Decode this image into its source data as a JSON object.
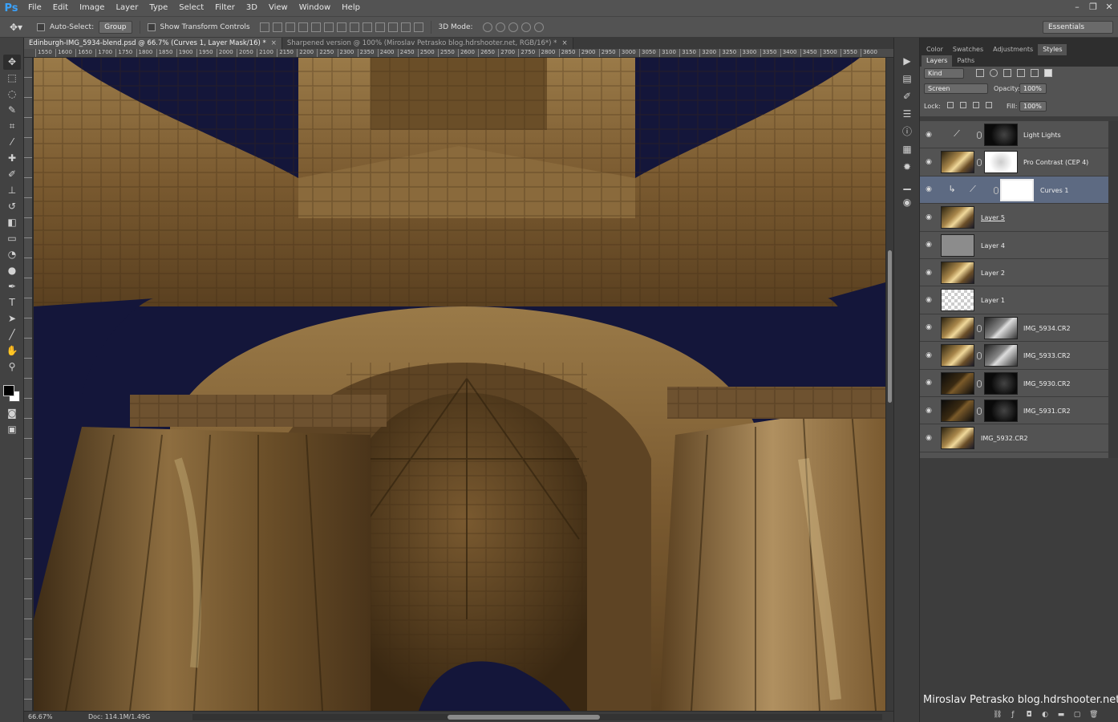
{
  "app": {
    "logo": "Ps"
  },
  "menu": [
    "File",
    "Edit",
    "Image",
    "Layer",
    "Type",
    "Select",
    "Filter",
    "3D",
    "View",
    "Window",
    "Help"
  ],
  "window_controls": [
    "–",
    "❐",
    "✕"
  ],
  "options": {
    "auto_select_label": "Auto-Select:",
    "auto_select_value": "Group",
    "transform_label": "Show Transform Controls",
    "mode_3d_label": "3D Mode:",
    "workspace": "Essentials"
  },
  "tabs": [
    {
      "label": "Edinburgh-IMG_5934-blend.psd @ 66.7% (Curves 1, Layer Mask/16) *",
      "active": true
    },
    {
      "label": "Sharpened version @ 100% (Miroslav Petrasko blog.hdrshooter.net, RGB/16*) *",
      "active": false
    }
  ],
  "ruler_ticks": [
    "1550",
    "1600",
    "1650",
    "1700",
    "1750",
    "1800",
    "1850",
    "1900",
    "1950",
    "2000",
    "2050",
    "2100",
    "2150",
    "2200",
    "2250",
    "2300",
    "2350",
    "2400",
    "2450",
    "2500",
    "2550",
    "2600",
    "2650",
    "2700",
    "2750",
    "2800",
    "2850",
    "2900",
    "2950",
    "3000",
    "3050",
    "3100",
    "3150",
    "3200",
    "3250",
    "3300",
    "3350",
    "3400",
    "3450",
    "3500",
    "3550",
    "3600"
  ],
  "status": {
    "zoom": "66.67%",
    "doc": "Doc: 114.1M/1.49G"
  },
  "panel_tabs": [
    "Color",
    "Swatches",
    "Adjustments",
    "Styles"
  ],
  "layer_tabs": [
    "Layers",
    "Paths"
  ],
  "layer_controls": {
    "filter_kind": "Kind",
    "blend_mode": "Screen",
    "opacity_label": "Opacity:",
    "opacity": "100%",
    "lock_label": "Lock:",
    "fill_label": "Fill:",
    "fill": "100%"
  },
  "layers": [
    {
      "name": "Light Lights",
      "type": "adjustment",
      "mask": "dark-mask"
    },
    {
      "name": "Pro Contrast (CEP 4)",
      "type": "image",
      "mask": "light-mask"
    },
    {
      "name": "Curves 1",
      "type": "adjustment-clipped",
      "mask": "white",
      "selected": true
    },
    {
      "name": "Layer 5",
      "type": "image",
      "underline": true
    },
    {
      "name": "Layer 4",
      "type": "gray"
    },
    {
      "name": "Layer 2",
      "type": "image"
    },
    {
      "name": "Layer 1",
      "type": "transparent"
    },
    {
      "name": "IMG_5934.CR2",
      "type": "image",
      "mask": "gray-mask"
    },
    {
      "name": "IMG_5933.CR2",
      "type": "image",
      "mask": "gray-mask"
    },
    {
      "name": "IMG_5930.CR2",
      "type": "dark",
      "mask": "dark-mask"
    },
    {
      "name": "IMG_5931.CR2",
      "type": "dark",
      "mask": "dark-mask"
    },
    {
      "name": "IMG_5932.CR2",
      "type": "image"
    }
  ],
  "watermark": "Miroslav  Petrasko  blog.hdrshooter.net",
  "colors": {
    "accent": "#3aa3ff",
    "selected_layer": "#5d6a82",
    "panel": "#535353",
    "sky": "#14163a",
    "stone": "#8a6a3a"
  }
}
